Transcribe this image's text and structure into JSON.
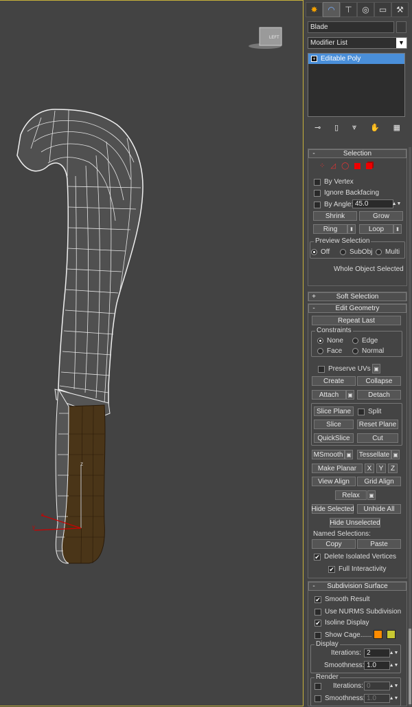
{
  "object_name": "Blade",
  "modifier_list": "Modifier List",
  "modifier_stack": [
    "Editable Poly"
  ],
  "viewcube_label": "LEFT",
  "gizmo": {
    "x": "x",
    "y": "y",
    "z": "z"
  },
  "tabs": [
    "create-icon",
    "modify-icon",
    "hierarchy-icon",
    "motion-icon",
    "display-icon",
    "utilities-icon"
  ],
  "selection": {
    "title": "Selection",
    "by_vertex": "By Vertex",
    "ignore_backfacing": "Ignore Backfacing",
    "by_angle": "By Angle:",
    "angle_value": "45.0",
    "shrink": "Shrink",
    "grow": "Grow",
    "ring": "Ring",
    "loop": "Loop",
    "preview_title": "Preview Selection",
    "preview_off": "Off",
    "preview_subobj": "SubObj",
    "preview_multi": "Multi",
    "status": "Whole Object Selected"
  },
  "soft_selection": {
    "title": "Soft Selection"
  },
  "edit_geometry": {
    "title": "Edit Geometry",
    "repeat_last": "Repeat Last",
    "constraints": "Constraints",
    "none": "None",
    "edge": "Edge",
    "face": "Face",
    "normal": "Normal",
    "preserve_uvs": "Preserve UVs",
    "create": "Create",
    "collapse": "Collapse",
    "attach": "Attach",
    "detach": "Detach",
    "slice_plane": "Slice Plane",
    "split": "Split",
    "slice": "Slice",
    "reset_plane": "Reset Plane",
    "quickslice": "QuickSlice",
    "cut": "Cut",
    "msmooth": "MSmooth",
    "tessellate": "Tessellate",
    "make_planar": "Make Planar",
    "x": "X",
    "y": "Y",
    "z": "Z",
    "view_align": "View Align",
    "grid_align": "Grid Align",
    "relax": "Relax",
    "hide_selected": "Hide Selected",
    "unhide_all": "Unhide All",
    "hide_unselected": "Hide Unselected",
    "named_selections": "Named Selections:",
    "copy": "Copy",
    "paste": "Paste",
    "delete_isolated": "Delete Isolated Vertices",
    "full_interactivity": "Full Interactivity"
  },
  "subdivision": {
    "title": "Subdivision Surface",
    "smooth_result": "Smooth Result",
    "use_nurms": "Use NURMS Subdivision",
    "isoline": "Isoline Display",
    "show_cage": "Show Cage......",
    "cage_color1": "#ff8c00",
    "cage_color2": "#c8c832",
    "display": "Display",
    "iterations": "Iterations:",
    "iterations_value": "2",
    "smoothness": "Smoothness:",
    "smoothness_value": "1.0",
    "render": "Render",
    "r_iterations": "Iterations:",
    "r_iterations_value": "0",
    "r_smoothness": "Smoothness:",
    "r_smoothness_value": "1.0"
  }
}
